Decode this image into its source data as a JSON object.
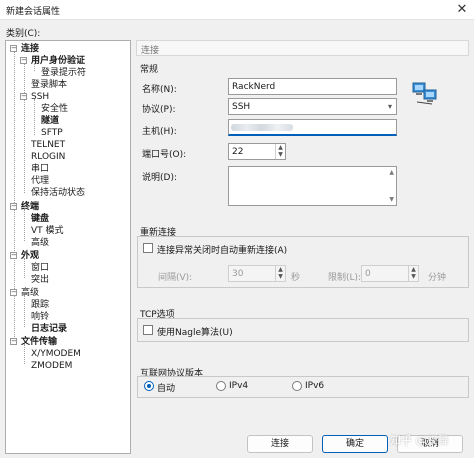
{
  "window": {
    "title": "新建会话属性",
    "close_glyph": "✕"
  },
  "category_label": "类别(C):",
  "tree": [
    {
      "label": "连接",
      "bold": true,
      "expander": "−"
    },
    {
      "label": "用户身份验证",
      "bold": true,
      "expander": "−"
    },
    {
      "label": "登录提示符",
      "bold": false
    },
    {
      "label": "登录脚本",
      "bold": false
    },
    {
      "label": "SSH",
      "bold": false,
      "expander": "−"
    },
    {
      "label": "安全性",
      "bold": false
    },
    {
      "label": "隧道",
      "bold": true
    },
    {
      "label": "SFTP",
      "bold": false
    },
    {
      "label": "TELNET",
      "bold": false
    },
    {
      "label": "RLOGIN",
      "bold": false
    },
    {
      "label": "串口",
      "bold": false
    },
    {
      "label": "代理",
      "bold": false
    },
    {
      "label": "保持活动状态",
      "bold": false
    },
    {
      "label": "终端",
      "bold": true,
      "expander": "−"
    },
    {
      "label": "键盘",
      "bold": true
    },
    {
      "label": "VT 模式",
      "bold": false
    },
    {
      "label": "高级",
      "bold": false
    },
    {
      "label": "外观",
      "bold": true,
      "expander": "−"
    },
    {
      "label": "窗口",
      "bold": false
    },
    {
      "label": "突出",
      "bold": false
    },
    {
      "label": "高级",
      "bold": false,
      "expander": "−"
    },
    {
      "label": "跟踪",
      "bold": false
    },
    {
      "label": "响铃",
      "bold": false
    },
    {
      "label": "日志记录",
      "bold": true
    },
    {
      "label": "文件传输",
      "bold": true,
      "expander": "−"
    },
    {
      "label": "X/YMODEM",
      "bold": false
    },
    {
      "label": "ZMODEM",
      "bold": false
    }
  ],
  "breadcrumb": "连接",
  "general": {
    "title": "常规",
    "name_label": "名称(N):",
    "name_value": "RackNerd",
    "protocol_label": "协议(P):",
    "protocol_value": "SSH",
    "host_label": "主机(H):",
    "port_label": "端口号(O):",
    "port_value": "22",
    "desc_label": "说明(D):"
  },
  "reconnect": {
    "title": "重新连接",
    "checkbox_label": "连接异常关闭时自动重新连接(A)",
    "interval_label": "间隔(V):",
    "interval_value": "30",
    "interval_unit": "秒",
    "limit_label": "限制(L):",
    "limit_value": "0",
    "limit_unit": "分钟"
  },
  "tcp": {
    "title": "TCP选项",
    "nagle_label": "使用Nagle算法(U)"
  },
  "ip_version": {
    "title": "互联网协议版本",
    "options": [
      "自动",
      "IPv4",
      "IPv6"
    ],
    "selected": "自动"
  },
  "buttons": {
    "connect": "连接",
    "ok": "确定",
    "cancel": "取消"
  },
  "watermark": "知乎 @双舞",
  "icons": {
    "close": "close-icon",
    "network": "network-computers-icon"
  },
  "colors": {
    "accent": "#005fb8",
    "border": "#adadad"
  }
}
